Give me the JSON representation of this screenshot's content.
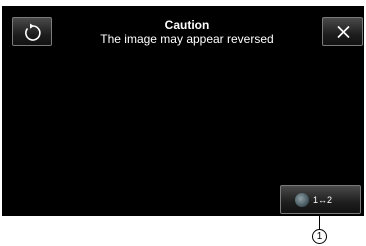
{
  "dialog": {
    "title": "Caution",
    "message": "The image may appear reversed"
  },
  "buttons": {
    "back_icon": "return-arrow-icon",
    "close_icon": "close-icon",
    "switch_icon": "camera-icon",
    "switch_label": "1↔2"
  },
  "callout": {
    "marker": "1"
  },
  "colors": {
    "screen_background": "#000000",
    "text": "#ffffff",
    "button_border": "#7a7a7a"
  }
}
